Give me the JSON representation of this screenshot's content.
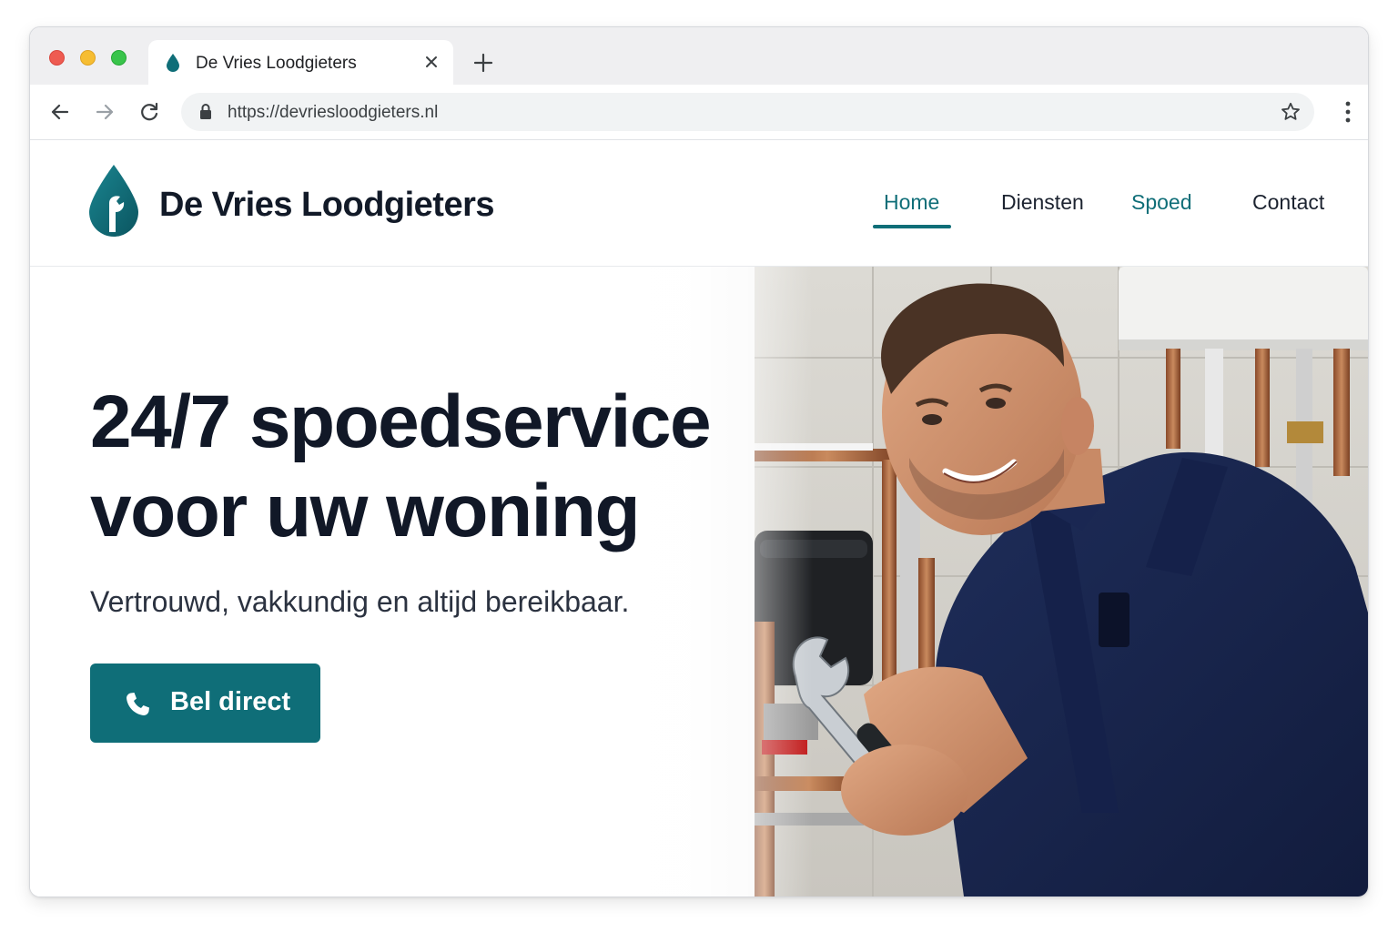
{
  "browser": {
    "tab_title": "De Vries Loodgieters",
    "url": "https://devriesloodgieters.nl"
  },
  "site": {
    "brand": "De Vries Loodgieters",
    "nav": {
      "home": "Home",
      "diensten": "Diensten",
      "spoed": "Spoed",
      "contact": "Contact"
    },
    "active_nav": "Home",
    "accent_color": "#0f6e78"
  },
  "hero": {
    "headline_line1": "24/7 spoedservice",
    "headline_line2": "voor uw woning",
    "subline": "Vertrouwd, vakkundig en altijd bereikbaar.",
    "cta_label": "Bel direct",
    "cta_icon": "phone-icon",
    "image": "plumber-with-wrench-photo"
  }
}
